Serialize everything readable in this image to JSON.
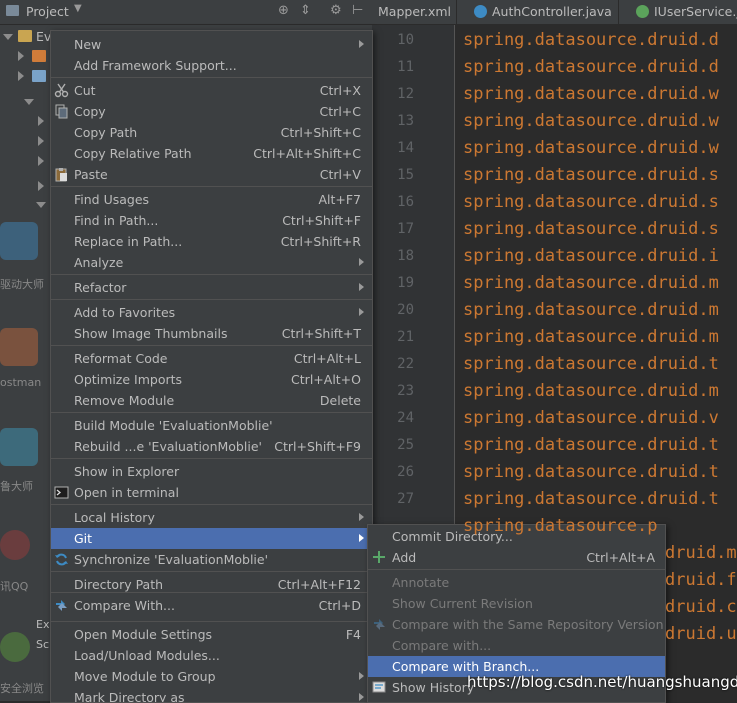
{
  "project": {
    "title": "Project",
    "tree_root_label": "Ev",
    "desktop_labels": [
      "驱动大师",
      "ostman",
      "鲁大师",
      "讯QQ",
      "Ex",
      "Sc",
      "安全浏览"
    ]
  },
  "editor": {
    "tabs": [
      {
        "label": "Mapper.xml"
      },
      {
        "label": "AuthController.java"
      },
      {
        "label": "IUserService.ja"
      }
    ],
    "line_numbers": [
      "10",
      "11",
      "12",
      "13",
      "14",
      "15",
      "16",
      "17",
      "18",
      "19",
      "20",
      "21",
      "22",
      "23",
      "24",
      "25",
      "26",
      "27"
    ],
    "code_lines": [
      "spring.datasource.druid.d",
      "spring.datasource.druid.d",
      "spring.datasource.druid.w",
      "spring.datasource.druid.w",
      "spring.datasource.druid.w",
      "spring.datasource.druid.s",
      "spring.datasource.druid.s",
      "spring.datasource.druid.s",
      "spring.datasource.druid.i",
      "spring.datasource.druid.m",
      "spring.datasource.druid.m",
      "spring.datasource.druid.m",
      "spring.datasource.druid.t",
      "spring.datasource.druid.m",
      "spring.datasource.druid.v",
      "spring.datasource.druid.t",
      "spring.datasource.druid.t",
      "spring.datasource.druid.t"
    ],
    "partial_lines": [
      "spring.datasource.p",
      "druid.m",
      "druid.f",
      "druid.c",
      "druid.u"
    ]
  },
  "context_menu": {
    "items": [
      {
        "label": "New",
        "shortcut": "",
        "submenu": true
      },
      {
        "label": "Add Framework Support...",
        "shortcut": ""
      },
      {
        "label": "Cut",
        "shortcut": "Ctrl+X",
        "icon": "scissors-icon"
      },
      {
        "label": "Copy",
        "shortcut": "Ctrl+C",
        "icon": "copy-icon"
      },
      {
        "label": "Copy Path",
        "shortcut": "Ctrl+Shift+C"
      },
      {
        "label": "Copy Relative Path",
        "shortcut": "Ctrl+Alt+Shift+C"
      },
      {
        "label": "Paste",
        "shortcut": "Ctrl+V",
        "icon": "paste-icon"
      },
      {
        "label": "Find Usages",
        "shortcut": "Alt+F7"
      },
      {
        "label": "Find in Path...",
        "shortcut": "Ctrl+Shift+F"
      },
      {
        "label": "Replace in Path...",
        "shortcut": "Ctrl+Shift+R"
      },
      {
        "label": "Analyze",
        "shortcut": "",
        "submenu": true
      },
      {
        "label": "Refactor",
        "shortcut": "",
        "submenu": true
      },
      {
        "label": "Add to Favorites",
        "shortcut": "",
        "submenu": true
      },
      {
        "label": "Show Image Thumbnails",
        "shortcut": "Ctrl+Shift+T"
      },
      {
        "label": "Reformat Code",
        "shortcut": "Ctrl+Alt+L"
      },
      {
        "label": "Optimize Imports",
        "shortcut": "Ctrl+Alt+O"
      },
      {
        "label": "Remove Module",
        "shortcut": "Delete"
      },
      {
        "label": "Build Module 'EvaluationMoblie'",
        "shortcut": ""
      },
      {
        "label": "Rebuild ...e 'EvaluationMoblie'",
        "shortcut": "Ctrl+Shift+F9"
      },
      {
        "label": "Show in Explorer",
        "shortcut": ""
      },
      {
        "label": "Open in terminal",
        "shortcut": "",
        "icon": "terminal-icon"
      },
      {
        "label": "Local History",
        "shortcut": "",
        "submenu": true
      },
      {
        "label": "Git",
        "shortcut": "",
        "submenu": true,
        "selected": true
      },
      {
        "label": "Synchronize 'EvaluationMoblie'",
        "shortcut": "",
        "icon": "sync-icon"
      },
      {
        "label": "Directory Path",
        "shortcut": "Ctrl+Alt+F12"
      },
      {
        "label": "Compare With...",
        "shortcut": "Ctrl+D",
        "icon": "compare-icon"
      },
      {
        "label": "Open Module Settings",
        "shortcut": "F4"
      },
      {
        "label": "Load/Unload Modules...",
        "shortcut": ""
      },
      {
        "label": "Move Module to Group",
        "shortcut": "",
        "submenu": true
      },
      {
        "label": "Mark Directory as",
        "shortcut": "",
        "submenu": true
      }
    ]
  },
  "git_submenu": {
    "items": [
      {
        "label": "Commit Directory...",
        "shortcut": "",
        "enabled": true
      },
      {
        "label": "Add",
        "shortcut": "Ctrl+Alt+A",
        "enabled": true,
        "icon": "plus-icon"
      },
      {
        "label": "Annotate",
        "shortcut": "",
        "enabled": false
      },
      {
        "label": "Show Current Revision",
        "shortcut": "",
        "enabled": false
      },
      {
        "label": "Compare with the Same Repository Version",
        "shortcut": "",
        "enabled": false,
        "icon": "compare-icon"
      },
      {
        "label": "Compare with...",
        "shortcut": "",
        "enabled": false
      },
      {
        "label": "Compare with Branch...",
        "shortcut": "",
        "enabled": true,
        "selected": true
      },
      {
        "label": "Show History",
        "shortcut": "",
        "enabled": true,
        "icon": "history-icon"
      }
    ]
  },
  "watermark": "https://blog.csdn.net/huangshuangda",
  "colors": {
    "background": "#2b2b2b",
    "panel": "#3c3f41",
    "selection": "#4b6eaf",
    "code_orange": "#cc7832",
    "add_green": "#59a869"
  }
}
